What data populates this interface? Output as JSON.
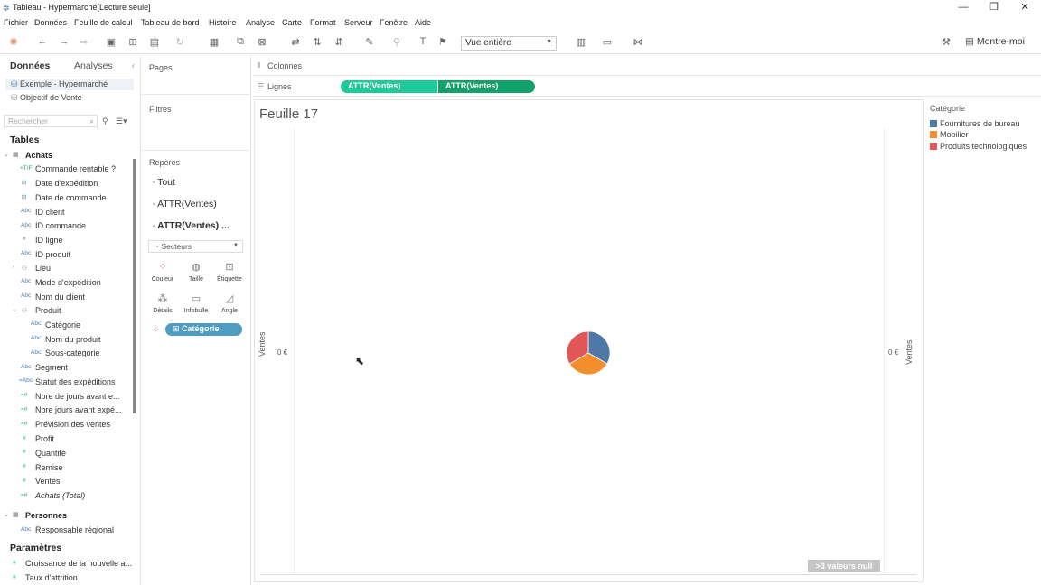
{
  "window": {
    "title": "Tableau - Hypermarché[Lecture seule]"
  },
  "menu": [
    "Fichier",
    "Données",
    "Feuille de calcul",
    "Tableau de bord",
    "Histoire",
    "Analyse",
    "Carte",
    "Format",
    "Serveur",
    "Fenêtre",
    "Aide"
  ],
  "toolbar": {
    "view_select": "Vue entière",
    "show_me": "Montre-moi"
  },
  "data_pane": {
    "tab_data": "Données",
    "tab_analytics": "Analyses",
    "sources": [
      "Exemple - Hypermarché",
      "Objectif de Vente"
    ],
    "search_placeholder": "Rechercher",
    "tables_heading": "Tables",
    "groups": [
      {
        "name": "Achats",
        "fields": [
          "Commande rentable ?",
          "Date d'expédition",
          "Date de commande",
          "ID client",
          "ID commande",
          "ID ligne",
          "ID produit",
          "Lieu",
          "Mode d'expédition",
          "Nom du client",
          "Produit",
          "Catégorie",
          "Nom du produit",
          "Sous-catégorie",
          "Segment",
          "Statut des expéditions",
          "Nbre de jours avant e...",
          "Nbre jours avant expé...",
          "Prévision des ventes",
          "Profit",
          "Quantité",
          "Remise",
          "Ventes",
          "Achats (Total)"
        ]
      },
      {
        "name": "Personnes",
        "fields": [
          "Responsable régional"
        ]
      }
    ],
    "params_heading": "Paramètres",
    "params": [
      "Croissance de la nouvelle a...",
      "Taux d'attrition"
    ]
  },
  "shelves": {
    "pages": "Pages",
    "filters": "Filtres",
    "marks": "Repères",
    "mark_items": [
      "Tout",
      "ATTR(Ventes)",
      "ATTR(Ventes) ..."
    ],
    "mark_type": "Secteurs",
    "mark_buttons": [
      "Couleur",
      "Taille",
      "Étiquette",
      "Détails",
      "Infobulle",
      "Angle"
    ],
    "color_pill": "Catégorie",
    "columns": "Colonnes",
    "rows": "Lignes",
    "row_pills": [
      "ATTR(Ventes)",
      "ATTR(Ventes)"
    ]
  },
  "view": {
    "sheet_title": "Feuille 17",
    "axis_label_left": "Ventes",
    "axis_label_right": "Ventes",
    "axis_value_left": "0 €",
    "axis_value_right": "0 €",
    "null_badge": ">3 valeurs null"
  },
  "legend": {
    "title": "Catégorie",
    "items": [
      {
        "label": "Fournitures de bureau",
        "color": "#4e79a7"
      },
      {
        "label": "Mobilier",
        "color": "#f28e2b"
      },
      {
        "label": "Produits technologiques",
        "color": "#e15759"
      }
    ]
  },
  "chart_data": {
    "type": "pie",
    "categories": [
      "Fournitures de bureau",
      "Mobilier",
      "Produits technologiques"
    ],
    "values": [
      33.3,
      33.3,
      33.4
    ],
    "colors": [
      "#4e79a7",
      "#f28e2b",
      "#e15759"
    ]
  }
}
